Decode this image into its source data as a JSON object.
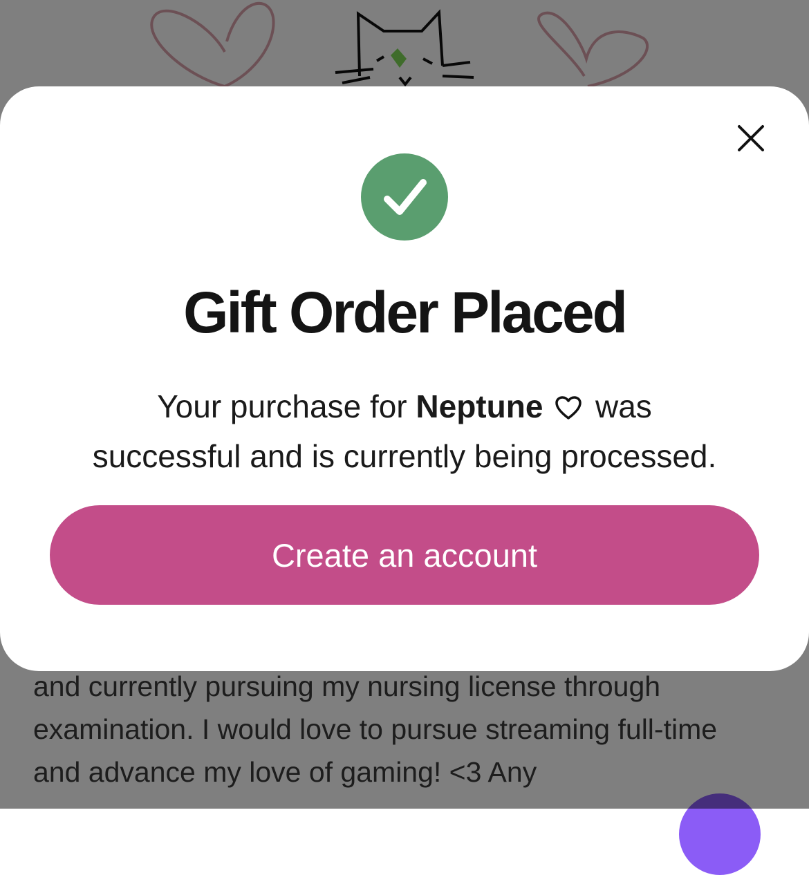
{
  "background": {
    "bio_text": "and currently pursuing my nursing license through examination. I would love to pursue streaming full-time and advance my love of gaming! <3 Any"
  },
  "modal": {
    "title": "Gift Order Placed",
    "message_prefix": "Your purchase for",
    "recipient_name": "Neptune",
    "message_mid": "was",
    "message_suffix": "successful and is currently being processed.",
    "cta_label": "Create an account",
    "icons": {
      "success": "check-circle-icon",
      "close": "close-icon",
      "heart": "heart-outline-icon"
    }
  },
  "colors": {
    "accent": "#c34d89",
    "success": "#5a9e6f",
    "overlay": "rgba(0,0,0,0.5)",
    "fab": "#8b5cf6"
  }
}
